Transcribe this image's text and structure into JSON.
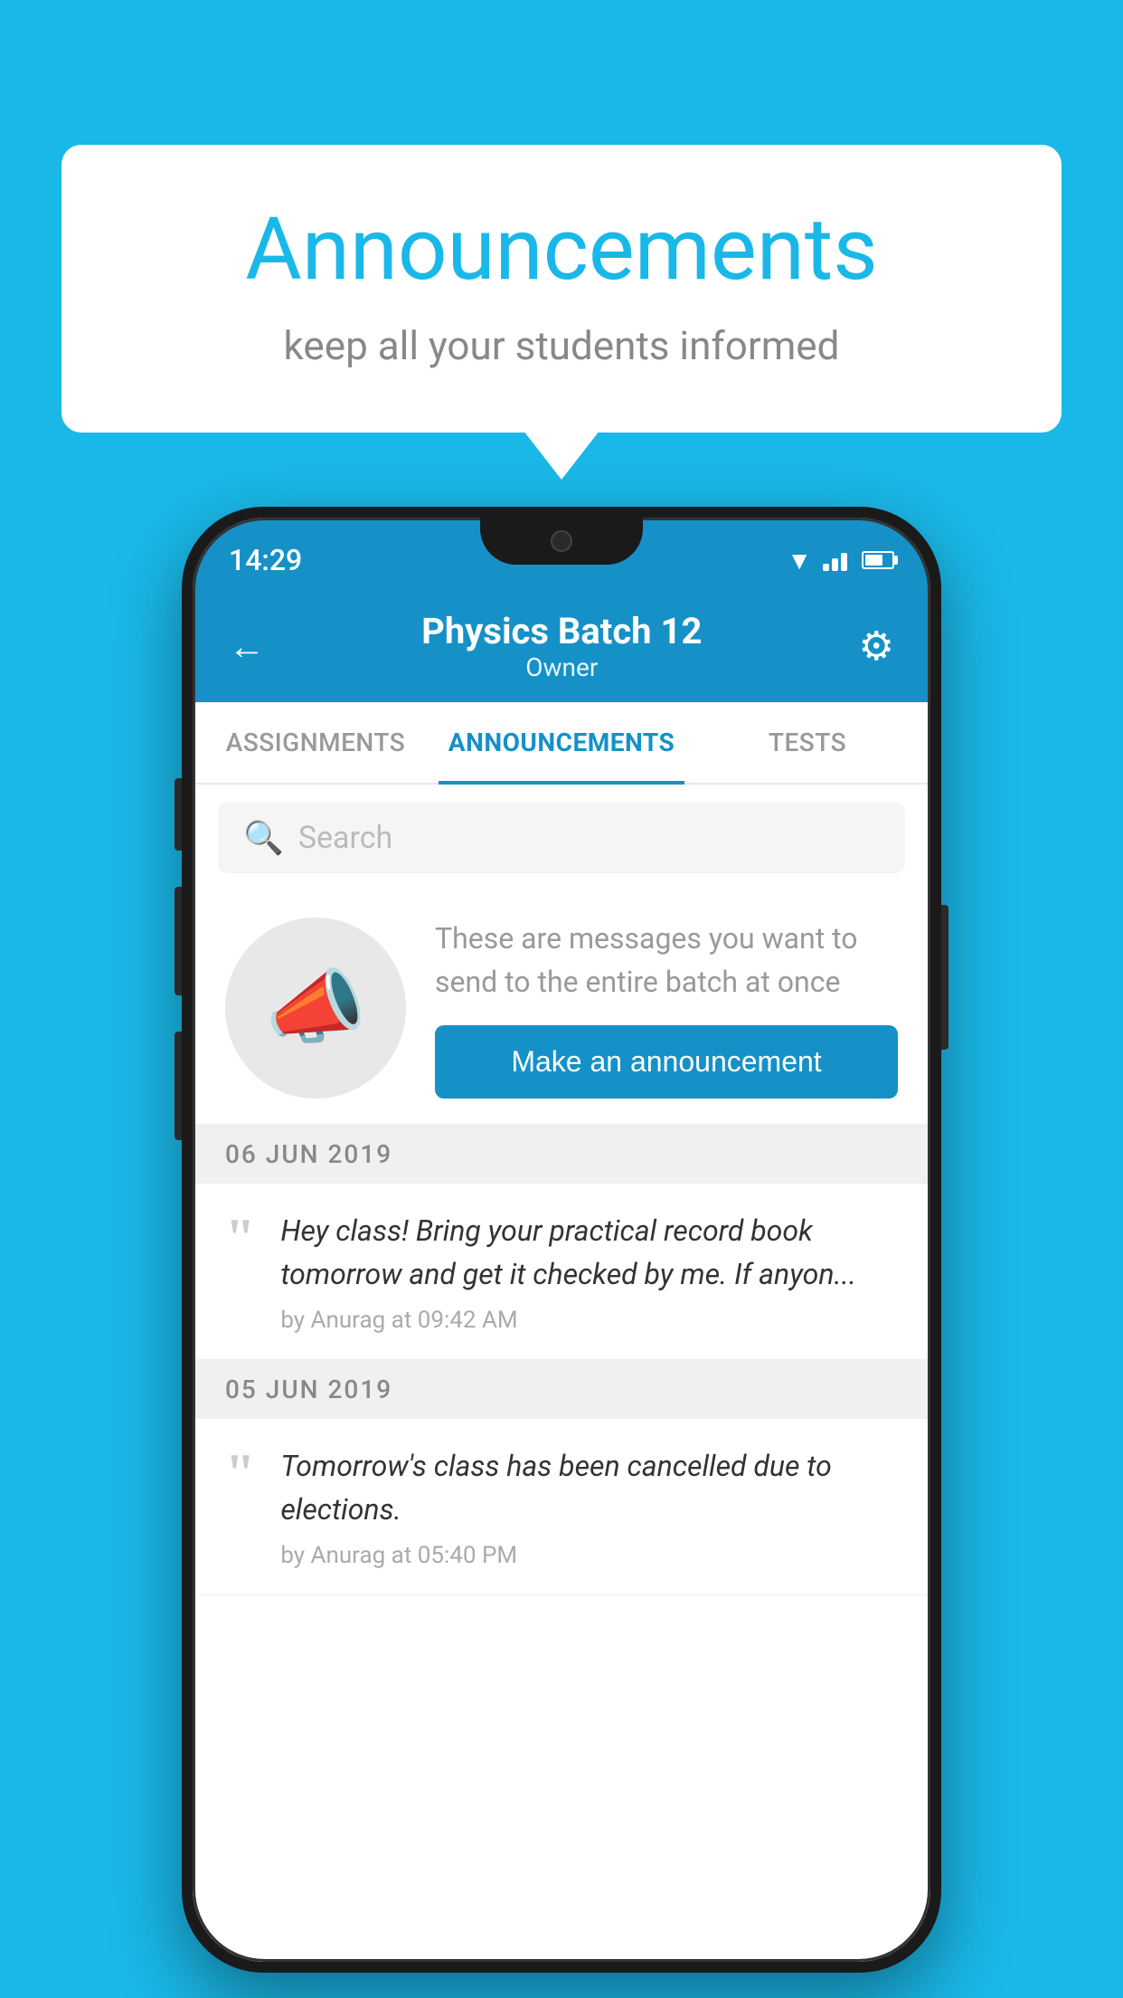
{
  "background_color": "#1ab8e8",
  "speech_bubble": {
    "title": "Announcements",
    "subtitle": "keep all your students informed"
  },
  "phone": {
    "status_bar": {
      "time": "14:29"
    },
    "app_bar": {
      "title": "Physics Batch 12",
      "subtitle": "Owner",
      "back_label": "←",
      "gear_label": "⚙"
    },
    "tabs": [
      {
        "label": "ASSIGNMENTS",
        "active": false
      },
      {
        "label": "ANNOUNCEMENTS",
        "active": true
      },
      {
        "label": "TESTS",
        "active": false
      }
    ],
    "search": {
      "placeholder": "Search"
    },
    "promo": {
      "text": "These are messages you want to send to the entire batch at once",
      "button_label": "Make an announcement"
    },
    "announcements": [
      {
        "date": "06  JUN  2019",
        "messages": [
          {
            "text": "Hey class! Bring your practical record book tomorrow and get it checked by me. If anyon...",
            "meta": "by Anurag at 09:42 AM"
          }
        ]
      },
      {
        "date": "05  JUN  2019",
        "messages": [
          {
            "text": "Tomorrow's class has been cancelled due to elections.",
            "meta": "by Anurag at 05:40 PM"
          }
        ]
      }
    ]
  }
}
